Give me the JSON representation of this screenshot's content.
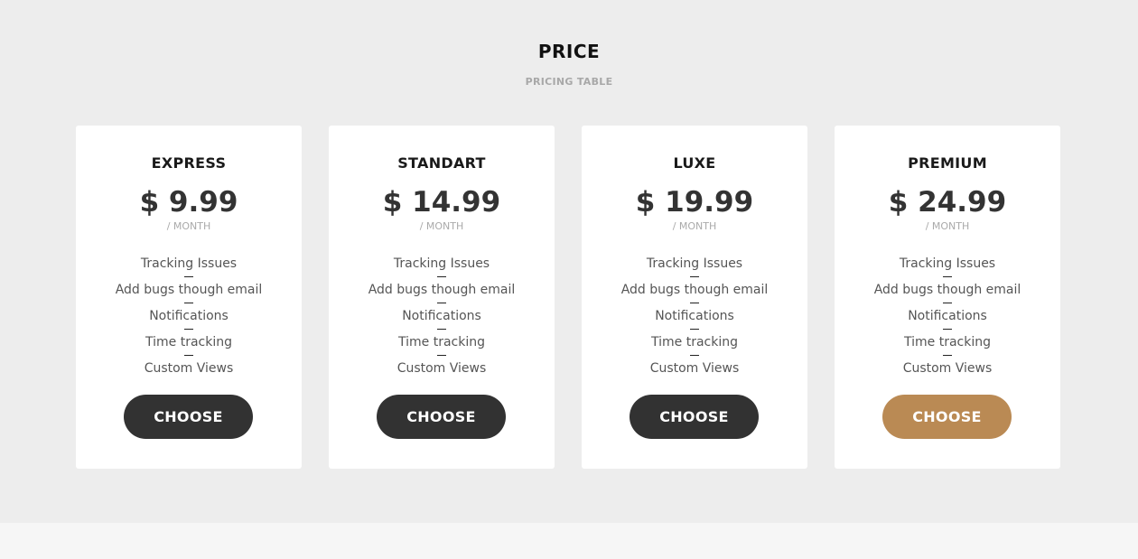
{
  "header": {
    "title": "PRICE",
    "subtitle": "PRICING TABLE"
  },
  "colors": {
    "section_background": "#ededed",
    "card_background": "#ffffff",
    "button_dark": "#323232",
    "button_accent": "#ba8a54"
  },
  "plans": [
    {
      "name": "EXPRESS",
      "price": "$ 9.99",
      "period": "/ MONTH",
      "features": [
        "Tracking Issues",
        "Add bugs though email",
        "Notifications",
        "Time tracking",
        "Custom Views"
      ],
      "button_label": "CHOOSE"
    },
    {
      "name": "STANDART",
      "price": "$ 14.99",
      "period": "/ MONTH",
      "features": [
        "Tracking Issues",
        "Add bugs though email",
        "Notifications",
        "Time tracking",
        "Custom Views"
      ],
      "button_label": "CHOOSE"
    },
    {
      "name": "LUXE",
      "price": "$ 19.99",
      "period": "/ MONTH",
      "features": [
        "Tracking Issues",
        "Add bugs though email",
        "Notifications",
        "Time tracking",
        "Custom Views"
      ],
      "button_label": "CHOOSE"
    },
    {
      "name": "PREMIUM",
      "price": "$ 24.99",
      "period": "/ MONTH",
      "features": [
        "Tracking Issues",
        "Add bugs though email",
        "Notifications",
        "Time tracking",
        "Custom Views"
      ],
      "button_label": "CHOOSE"
    }
  ]
}
